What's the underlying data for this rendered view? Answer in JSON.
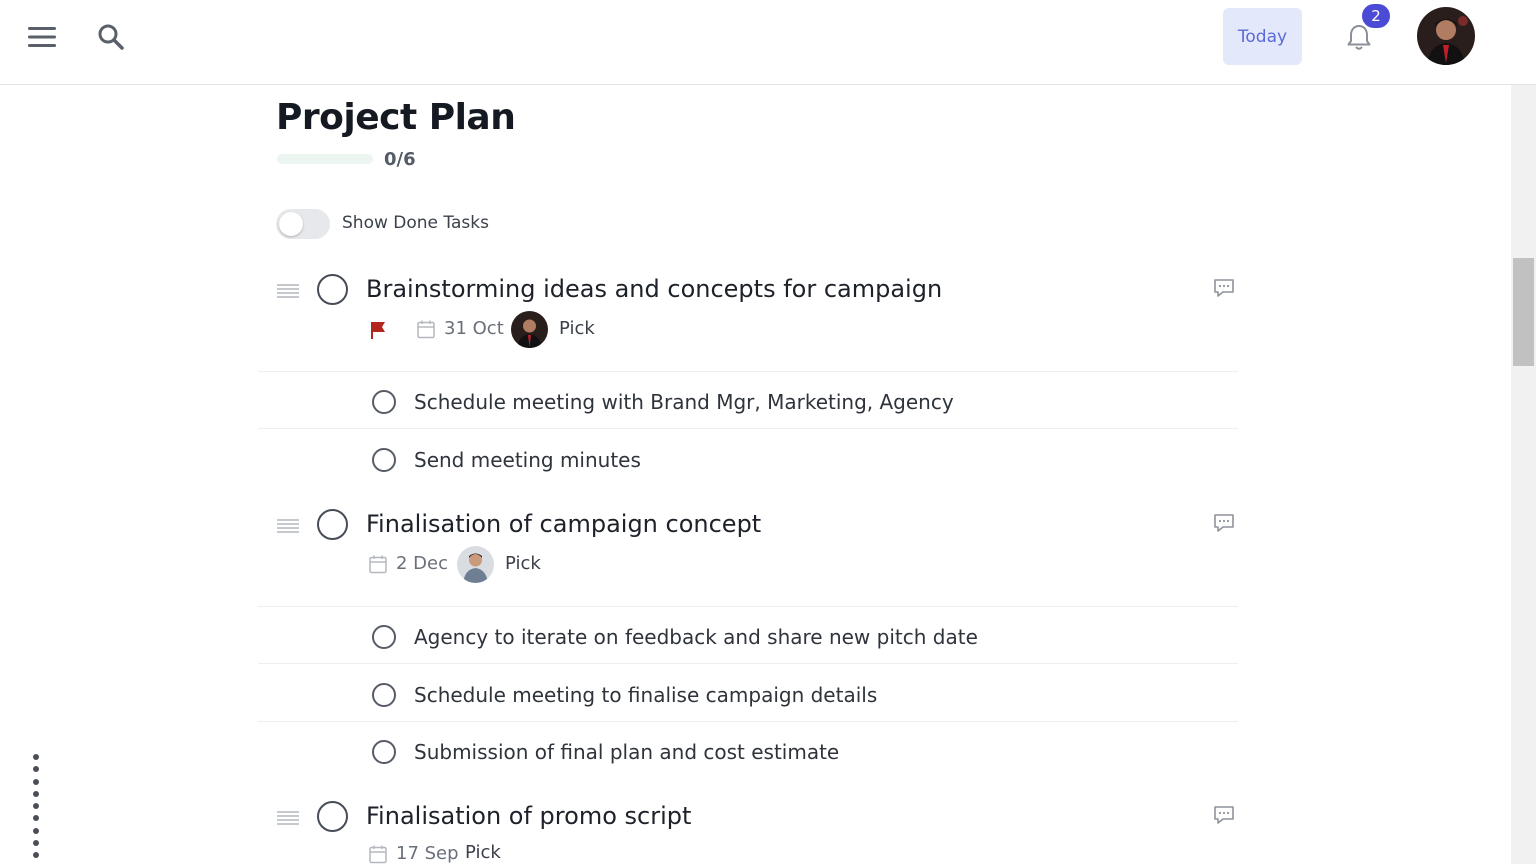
{
  "header": {
    "today_label": "Today",
    "notification_count": "2"
  },
  "project": {
    "title": "Project Plan",
    "progress_text": "0/6",
    "progress_fraction": 0,
    "show_done_label": "Show Done Tasks",
    "show_done_enabled": false
  },
  "tasks": [
    {
      "title": "Brainstorming ideas and concepts for campaign",
      "flag": true,
      "flag_color": "#b3261e",
      "date": "31 Oct",
      "assignee_label": "Pick",
      "subtasks": [
        "Schedule meeting with Brand Mgr, Marketing, Agency",
        "Send meeting minutes"
      ]
    },
    {
      "title": "Finalisation of campaign concept",
      "flag": false,
      "date": "2 Dec",
      "assignee_label": "Pick",
      "subtasks": [
        "Agency to iterate on feedback and share new pitch date",
        "Schedule meeting to finalise campaign details",
        "Submission of final plan and cost estimate"
      ]
    },
    {
      "title": "Finalisation of promo script",
      "flag": false,
      "date": "17 Sep",
      "assignee_label": "Pick",
      "subtasks": []
    }
  ],
  "colors": {
    "accent": "#4b4bd6",
    "today_bg": "#e4e8fb",
    "today_text": "#5b6ad6"
  },
  "icons": [
    "menu-icon",
    "search-icon",
    "bell-icon",
    "drag-handle-icon",
    "comment-icon",
    "flag-icon",
    "calendar-icon",
    "more-dots-icon"
  ]
}
